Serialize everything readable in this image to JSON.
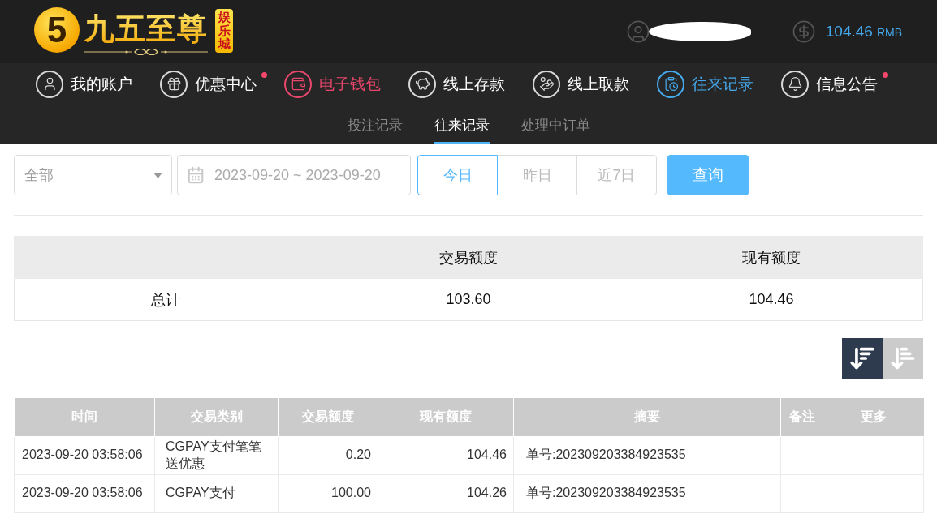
{
  "header": {
    "logo": {
      "mark": "5",
      "name": "九五至尊",
      "badge": "娱乐城"
    },
    "user": {
      "name_hidden": true
    },
    "balance": {
      "amount": "104.46",
      "currency": "RMB"
    }
  },
  "nav": {
    "items": [
      {
        "label": "我的账户",
        "selected": false,
        "highlighted": false,
        "badge": false
      },
      {
        "label": "优惠中心",
        "selected": false,
        "highlighted": false,
        "badge": true
      },
      {
        "label": "电子钱包",
        "selected": false,
        "highlighted": true,
        "badge": false
      },
      {
        "label": "线上存款",
        "selected": false,
        "highlighted": false,
        "badge": false
      },
      {
        "label": "线上取款",
        "selected": false,
        "highlighted": false,
        "badge": false
      },
      {
        "label": "往来记录",
        "selected": true,
        "highlighted": false,
        "badge": false
      },
      {
        "label": "信息公告",
        "selected": false,
        "highlighted": false,
        "badge": true
      }
    ]
  },
  "subtabs": [
    {
      "label": "投注记录",
      "selected": false
    },
    {
      "label": "往来记录",
      "selected": true
    },
    {
      "label": "处理中订单",
      "selected": false
    }
  ],
  "filters": {
    "type_select": {
      "value": "全部"
    },
    "date_range": {
      "value": "2023-09-20 ~ 2023-09-20"
    },
    "quick_ranges": [
      {
        "label": "今日",
        "selected": true
      },
      {
        "label": "昨日",
        "selected": false
      },
      {
        "label": "近7日",
        "selected": false
      }
    ],
    "query_button": "查询"
  },
  "summary": {
    "columns": [
      "交易额度",
      "现有额度"
    ],
    "rows": [
      {
        "label": "总计",
        "values": [
          "103.60",
          "104.46"
        ]
      }
    ]
  },
  "sort_buttons": [
    {
      "kind": "descending",
      "selected": true
    },
    {
      "kind": "ascending",
      "selected": false
    }
  ],
  "table": {
    "columns": [
      "时间",
      "交易类别",
      "交易额度",
      "现有额度",
      "摘要",
      "备注",
      "更多"
    ],
    "rows": [
      [
        "2023-09-20 03:58:06",
        "CGPAY支付笔笔送优惠",
        "0.20",
        "104.46",
        "单号:202309203384923535"
      ],
      [
        "2023-09-20 03:58:06",
        "CGPAY支付",
        "100.00",
        "104.26",
        "单号:202309203384923535"
      ]
    ]
  }
}
